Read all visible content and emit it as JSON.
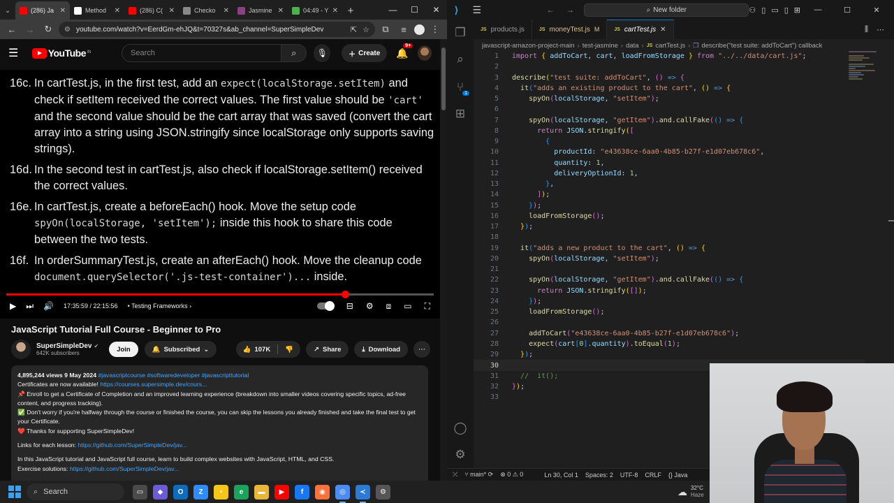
{
  "chrome": {
    "tabs": [
      {
        "label": "(286) Ja",
        "fav_color": "#ff0000",
        "active": true
      },
      {
        "label": "Method",
        "fav_color": "#ffffff",
        "active": false
      },
      {
        "label": "(286) C(",
        "fav_color": "#ff0000",
        "active": false
      },
      {
        "label": "Checko",
        "fav_color": "#888888",
        "active": false
      },
      {
        "label": "Jasmine",
        "fav_color": "#8a4182",
        "active": false
      },
      {
        "label": "04:49 - Y",
        "fav_color": "#4caf50",
        "active": false
      }
    ],
    "new_tab_icon": "plus-icon",
    "url": "youtube.com/watch?v=EerdGm-ehJQ&t=70327s&ab_channel=SuperSimpleDev"
  },
  "youtube": {
    "logo_text": "YouTube",
    "logo_sup": "IN",
    "search_placeholder": "Search",
    "create_label": "Create",
    "notif_count": "9+",
    "slides": [
      {
        "num": "16c.",
        "text_html": "In cartTest.js, in the first test, add an <span class=\"mono\">expect(localStorage.setItem)</span> and check if setItem received the correct values. The first value should be <span class=\"mono\">'cart'</span> and the second value should be the cart array that was saved (convert the cart array into a string using JSON.stringify since localStorage only supports saving strings)."
      },
      {
        "num": "16d.",
        "text_html": "In the second test in cartTest.js, also check if localStorage.setItem() received the correct values."
      },
      {
        "num": "16e.",
        "text_html": "In cartTest.js, create a beforeEach() hook. Move the setup code <span class=\"mono\">spyOn(localStorage, 'setItem');</span> inside this hook to share this code between the two tests."
      },
      {
        "num": "16f.",
        "text_html": "In orderSummaryTest.js, create an afterEach() hook. Move the cleanup code <span class=\"mono\">document.querySelector('.js-test-container')...</span> inside."
      }
    ],
    "progress": {
      "played": 0.793,
      "buffered": 0.8
    },
    "time": "17:35:59 / 22:15:56",
    "chapter": "Testing Frameworks",
    "video_title": "JavaScript Tutorial Full Course - Beginner to Pro",
    "channel_name": "SuperSimpleDev",
    "subscribers": "642K subscribers",
    "join_label": "Join",
    "subscribed_label": "Subscribed",
    "likes": "107K",
    "share_label": "Share",
    "download_label": "Download",
    "desc_meta": "4,895,244 views  9 May 2024",
    "desc_tags": "#javascriptcourse #softwaredeveloper #javascripttutorial",
    "desc_lines": [
      {
        "text": "Certificates are now available! ",
        "link": "https://courses.supersimple.dev/cours..."
      },
      {
        "text": "📌 Enroll to get a Certificate of Completion and an improved learning experience (breakdown into smaller videos covering specific topics, ad-free content, and progress tracking).",
        "link": ""
      },
      {
        "text": "✅ Don't worry if you're halfway through the course or finished the course, you can skip the lessons you already finished and take the final test to get your Certificate.",
        "link": ""
      },
      {
        "text": "❤️ Thanks for supporting SuperSimpleDev!",
        "link": ""
      },
      {
        "text": "",
        "link": ""
      },
      {
        "text": "Links for each lesson: ",
        "link": "https://github.com/SuperSimpleDev/jav..."
      },
      {
        "text": "",
        "link": ""
      },
      {
        "text": "In this JavaScript tutorial and JavaScript full course, learn to build complex websites with JavaScript, HTML, and CSS.",
        "link": ""
      },
      {
        "text": "Exercise solutions: ",
        "link": "https://github.com/SuperSimpleDev/jav..."
      }
    ]
  },
  "vscode": {
    "title_search": "New folder",
    "tabs": [
      {
        "name": "products.js",
        "modified": false,
        "active": false
      },
      {
        "name": "moneyTest.js",
        "modified": true,
        "active": false
      },
      {
        "name": "cartTest.js",
        "modified": false,
        "active": true
      }
    ],
    "breadcrumbs": [
      "javascript-amazon-project-main",
      "test-jasmine",
      "data",
      "cartTest.js",
      "describe(\"test suite: addToCart\") callback"
    ],
    "code_lines": [
      {
        "n": "1",
        "html": "<span class=\"k\">import</span> <span class=\"b1\">{</span> <span class=\"v\">addToCart</span>, <span class=\"v\">cart</span>, <span class=\"v\">loadFromStorage</span> <span class=\"b1\">}</span> <span class=\"k\">from</span> <span class=\"s\">\"../../data/cart.js\"</span>;"
      },
      {
        "n": "2",
        "html": ""
      },
      {
        "n": "3",
        "html": "<span class=\"f\">describe</span><span class=\"b1\">(</span><span class=\"s\">\"test suite: addToCart\"</span>, <span class=\"b2\">()</span> <span class=\"kw\">=&gt;</span> <span class=\"b2\">{</span>"
      },
      {
        "n": "4",
        "html": "  <span class=\"f\">it</span><span class=\"b3\">(</span><span class=\"s\">\"adds an existing product to the cart\"</span>, <span class=\"b1\">()</span> <span class=\"kw\">=&gt;</span> <span class=\"b1\">{</span>"
      },
      {
        "n": "5",
        "html": "    <span class=\"f\">spyOn</span><span class=\"b2\">(</span><span class=\"v\">localStorage</span>, <span class=\"s\">\"setItem\"</span><span class=\"b2\">)</span>;"
      },
      {
        "n": "6",
        "html": ""
      },
      {
        "n": "7",
        "html": "    <span class=\"f\">spyOn</span><span class=\"b2\">(</span><span class=\"v\">localStorage</span>, <span class=\"s\">\"getItem\"</span><span class=\"b2\">)</span>.<span class=\"f\">and</span>.<span class=\"f\">callFake</span><span class=\"b2\">(</span><span class=\"b3\">()</span> <span class=\"kw\">=&gt;</span> <span class=\"b3\">{</span>"
      },
      {
        "n": "8",
        "html": "      <span class=\"k\">return</span> <span class=\"v\">JSON</span>.<span class=\"f\">stringify</span><span class=\"b1\">(</span><span class=\"b2\">[</span>"
      },
      {
        "n": "9",
        "html": "        <span class=\"b3\">{</span>"
      },
      {
        "n": "10",
        "html": "          <span class=\"v\">productId</span>: <span class=\"s\">\"e43638ce-6aa0-4b85-b27f-e1d07eb678c6\"</span>,"
      },
      {
        "n": "11",
        "html": "          <span class=\"v\">quantity</span>: <span class=\"n\">1</span>,"
      },
      {
        "n": "12",
        "html": "          <span class=\"v\">deliveryOptionId</span>: <span class=\"n\">1</span>,"
      },
      {
        "n": "13",
        "html": "        <span class=\"b3\">}</span>,"
      },
      {
        "n": "14",
        "html": "      <span class=\"b2\">]</span><span class=\"b1\">)</span>;"
      },
      {
        "n": "15",
        "html": "    <span class=\"b3\">}</span><span class=\"b2\">)</span>;"
      },
      {
        "n": "16",
        "html": "    <span class=\"f\">loadFromStorage</span><span class=\"b2\">()</span>;"
      },
      {
        "n": "17",
        "html": "  <span class=\"b1\">}</span><span class=\"b3\">)</span>;"
      },
      {
        "n": "18",
        "html": ""
      },
      {
        "n": "19",
        "html": "  <span class=\"f\">it</span><span class=\"b3\">(</span><span class=\"s\">\"adds a new product to the cart\"</span>, <span class=\"b1\">()</span> <span class=\"kw\">=&gt;</span> <span class=\"b1\">{</span>"
      },
      {
        "n": "20",
        "html": "    <span class=\"f\">spyOn</span><span class=\"b2\">(</span><span class=\"v\">localStorage</span>, <span class=\"s\">\"setItem\"</span><span class=\"b2\">)</span>;"
      },
      {
        "n": "21",
        "html": ""
      },
      {
        "n": "22",
        "html": "    <span class=\"f\">spyOn</span><span class=\"b2\">(</span><span class=\"v\">localStorage</span>, <span class=\"s\">\"getItem\"</span><span class=\"b2\">)</span>.<span class=\"f\">and</span>.<span class=\"f\">callFake</span><span class=\"b2\">(</span><span class=\"b3\">()</span> <span class=\"kw\">=&gt;</span> <span class=\"b3\">{</span>"
      },
      {
        "n": "23",
        "html": "      <span class=\"k\">return</span> <span class=\"v\">JSON</span>.<span class=\"f\">stringify</span><span class=\"b1\">(</span><span class=\"b2\">[]</span><span class=\"b1\">)</span>;"
      },
      {
        "n": "24",
        "html": "    <span class=\"b3\">}</span><span class=\"b2\">)</span>;"
      },
      {
        "n": "25",
        "html": "    <span class=\"f\">loadFromStorage</span><span class=\"b2\">()</span>;"
      },
      {
        "n": "26",
        "html": ""
      },
      {
        "n": "27",
        "html": "    <span class=\"f\">addToCart</span><span class=\"b2\">(</span><span class=\"s\">\"e43638ce-6aa0-4b85-b27f-e1d07eb678c6\"</span><span class=\"b2\">)</span>;"
      },
      {
        "n": "28",
        "html": "    <span class=\"f\">expect</span><span class=\"b2\">(</span><span class=\"v\">cart</span><span class=\"b3\">[</span><span class=\"n\">0</span><span class=\"b3\">]</span>.<span class=\"v\">quantity</span><span class=\"b2\">)</span>.<span class=\"f\">toEqual</span><span class=\"b2\">(</span><span class=\"n\">1</span><span class=\"b2\">)</span>;"
      },
      {
        "n": "29",
        "html": "  <span class=\"b1\">}</span><span class=\"b3\">)</span>;"
      },
      {
        "n": "30",
        "html": ""
      },
      {
        "n": "31",
        "html": "  <span class=\"c\">//  it();</span>"
      },
      {
        "n": "32",
        "html": "<span class=\"b2\">}</span><span class=\"b1\">)</span>;"
      },
      {
        "n": "33",
        "html": ""
      }
    ],
    "current_line": "30",
    "status": {
      "branch": "main*",
      "problems": "⊗ 0 ⚠ 0",
      "position": "Ln 30, Col 1",
      "spaces": "Spaces: 2",
      "encoding": "UTF-8",
      "eol": "CRLF",
      "language": "{} Java"
    }
  },
  "taskbar": {
    "search_label": "Search",
    "weather_temp": "32°C",
    "weather_desc": "Haze",
    "apps": [
      {
        "name": "task-view-icon",
        "color": "#4a4a4a",
        "glyph": "▭",
        "active": false
      },
      {
        "name": "copilot-icon",
        "color": "#6b5bd6",
        "glyph": "◆",
        "active": false
      },
      {
        "name": "outlook-icon",
        "color": "#0f6cbd",
        "glyph": "O",
        "active": false
      },
      {
        "name": "zoom-icon",
        "color": "#2d8cff",
        "glyph": "Z",
        "active": false
      },
      {
        "name": "sticky-notes-icon",
        "color": "#f5c518",
        "glyph": "▪",
        "active": false
      },
      {
        "name": "edge-icon",
        "color": "#1aa35a",
        "glyph": "e",
        "active": false
      },
      {
        "name": "file-explorer-icon",
        "color": "#e8b73a",
        "glyph": "▬",
        "active": false
      },
      {
        "name": "youtube-app-icon",
        "color": "#ff0000",
        "glyph": "▶",
        "active": false
      },
      {
        "name": "facebook-icon",
        "color": "#1877f2",
        "glyph": "f",
        "active": false
      },
      {
        "name": "firefox-icon",
        "color": "#ff7139",
        "glyph": "◉",
        "active": false
      },
      {
        "name": "chrome-icon",
        "color": "#4c8bf5",
        "glyph": "◎",
        "active": true
      },
      {
        "name": "vscode-icon",
        "color": "#2a7ad6",
        "glyph": "≺",
        "active": true
      },
      {
        "name": "settings-icon",
        "color": "#555555",
        "glyph": "⚙",
        "active": false
      }
    ]
  }
}
